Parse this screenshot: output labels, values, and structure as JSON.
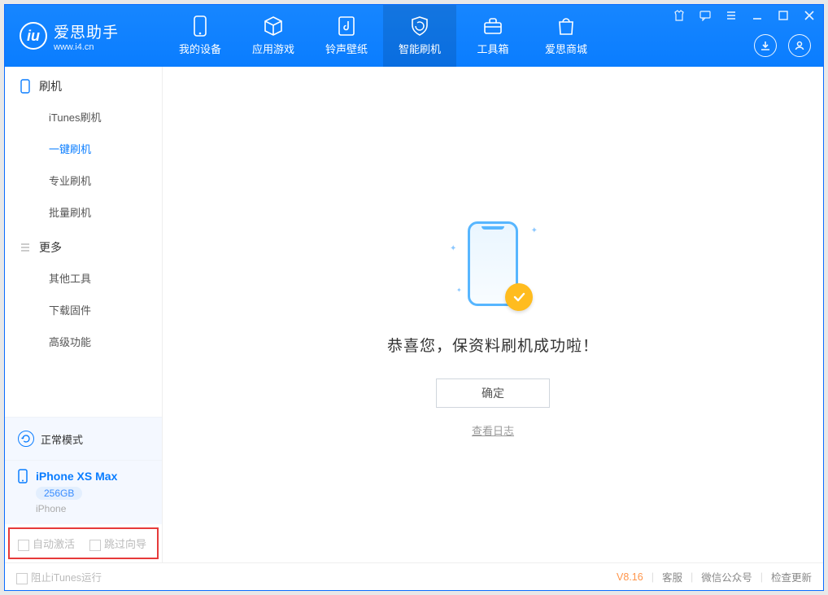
{
  "app": {
    "name": "爱思助手",
    "url": "www.i4.cn"
  },
  "nav": [
    {
      "label": "我的设备",
      "icon": "phone"
    },
    {
      "label": "应用游戏",
      "icon": "cube"
    },
    {
      "label": "铃声壁纸",
      "icon": "music"
    },
    {
      "label": "智能刷机",
      "icon": "shield",
      "active": true
    },
    {
      "label": "工具箱",
      "icon": "toolbox"
    },
    {
      "label": "爱思商城",
      "icon": "bag"
    }
  ],
  "sidebar": {
    "section1": {
      "title": "刷机",
      "items": [
        "iTunes刷机",
        "一键刷机",
        "专业刷机",
        "批量刷机"
      ],
      "activeIndex": 1
    },
    "section2": {
      "title": "更多",
      "items": [
        "其他工具",
        "下载固件",
        "高级功能"
      ]
    }
  },
  "device": {
    "mode": "正常模式",
    "name": "iPhone XS Max",
    "capacity": "256GB",
    "type": "iPhone"
  },
  "options": {
    "auto_activate": "自动激活",
    "skip_wizard": "跳过向导"
  },
  "result": {
    "message": "恭喜您，保资料刷机成功啦！",
    "ok": "确定",
    "view_log": "查看日志"
  },
  "footer": {
    "block_itunes": "阻止iTunes运行",
    "version": "V8.16",
    "support": "客服",
    "wechat": "微信公众号",
    "check_update": "检查更新"
  }
}
